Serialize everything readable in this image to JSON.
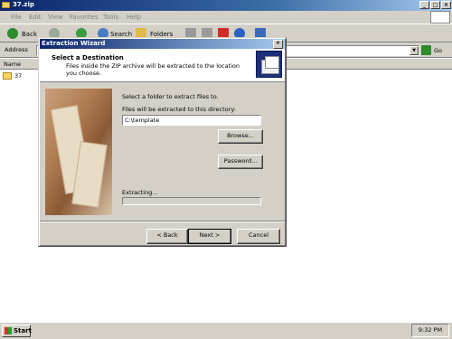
{
  "window": {
    "title": "37.zip",
    "controls": [
      "_",
      "□",
      "×"
    ]
  },
  "menu": [
    "File",
    "Edit",
    "View",
    "Favorites",
    "Tools",
    "Help"
  ],
  "toolbar": {
    "back_label": "Back",
    "search_label": "Search",
    "folders_label": "Folders"
  },
  "address": {
    "label": "Address",
    "go_label": "Go"
  },
  "list": {
    "column_name": "Name",
    "items": [
      "37"
    ]
  },
  "dialog": {
    "title": "Extraction Wizard",
    "header_title": "Select a Destination",
    "header_subtitle": "Files inside the ZIP archive will be extracted to the location you choose.",
    "instruction": "Select a folder to extract files to.",
    "path_label": "Files will be extracted to this directory:",
    "path_value": "C:\\template",
    "browse_label": "Browse...",
    "password_label": "Password...",
    "extracting_label": "Extracting...",
    "progress": 0,
    "back_label": "< Back",
    "next_label": "Next >",
    "cancel_label": "Cancel"
  },
  "taskbar": {
    "start_label": "Start",
    "clock": "9:32 PM"
  },
  "colors": {
    "title_start": "#0a246a",
    "title_end": "#a6caf0",
    "face": "#d4d0c8"
  }
}
